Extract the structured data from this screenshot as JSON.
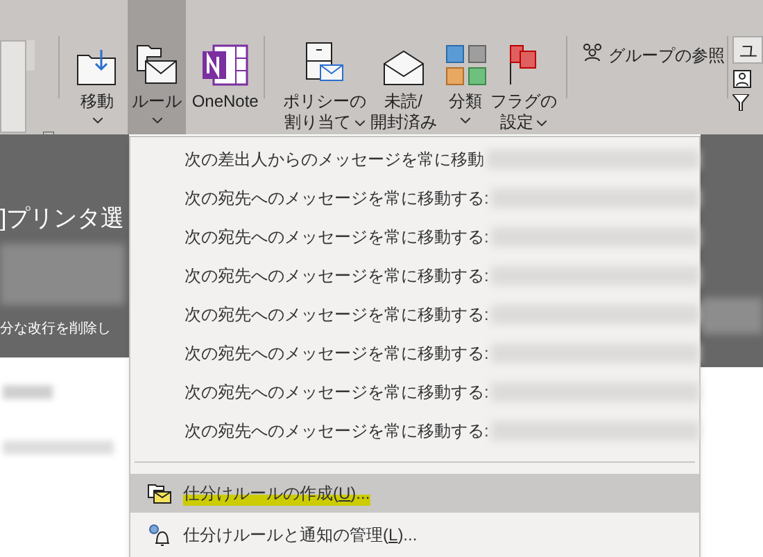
{
  "ribbon": {
    "buttons": [
      {
        "kind": "move",
        "label": [
          "移動"
        ],
        "dropdown": true,
        "selected": false
      },
      {
        "kind": "rules",
        "label": [
          "ルール"
        ],
        "dropdown": true,
        "selected": true
      },
      {
        "kind": "onenote",
        "label": [
          "OneNote"
        ],
        "dropdown": false,
        "selected": false
      },
      {
        "kind": "policy",
        "label": [
          "ポリシーの",
          "割り当て"
        ],
        "dropdown": true,
        "selected": false
      },
      {
        "kind": "read",
        "label": [
          "未読/",
          "開封済み"
        ],
        "dropdown": false,
        "selected": false
      },
      {
        "kind": "categorize",
        "label": [
          "分類"
        ],
        "dropdown": true,
        "selected": false
      },
      {
        "kind": "flag",
        "label": [
          "フラグの",
          "設定"
        ],
        "dropdown": true,
        "selected": false
      }
    ],
    "group_browse": "グループの参照",
    "right_field": "ユ"
  },
  "message": {
    "subject": "]プリンタ選",
    "info_line": "分な改行を削除し"
  },
  "rules_menu": {
    "items": [
      {
        "kind": "rule",
        "text": "次の差出人からのメッセージを常に移動"
      },
      {
        "kind": "rule",
        "text": "次の宛先へのメッセージを常に移動する:"
      },
      {
        "kind": "rule",
        "text": "次の宛先へのメッセージを常に移動する:"
      },
      {
        "kind": "rule",
        "text": "次の宛先へのメッセージを常に移動する:"
      },
      {
        "kind": "rule",
        "text": "次の宛先へのメッセージを常に移動する:"
      },
      {
        "kind": "rule",
        "text": "次の宛先へのメッセージを常に移動する:"
      },
      {
        "kind": "rule",
        "text": "次の宛先へのメッセージを常に移動する:"
      },
      {
        "kind": "rule",
        "text": "次の宛先へのメッセージを常に移動する:"
      },
      {
        "kind": "create",
        "before": "仕分けルールの作成(",
        "accelerator": "U",
        "after": ")...",
        "selected": true
      },
      {
        "kind": "manage",
        "before": "仕分けルールと通知の管理(",
        "accelerator": "L",
        "after": ")...",
        "selected": false
      }
    ]
  }
}
